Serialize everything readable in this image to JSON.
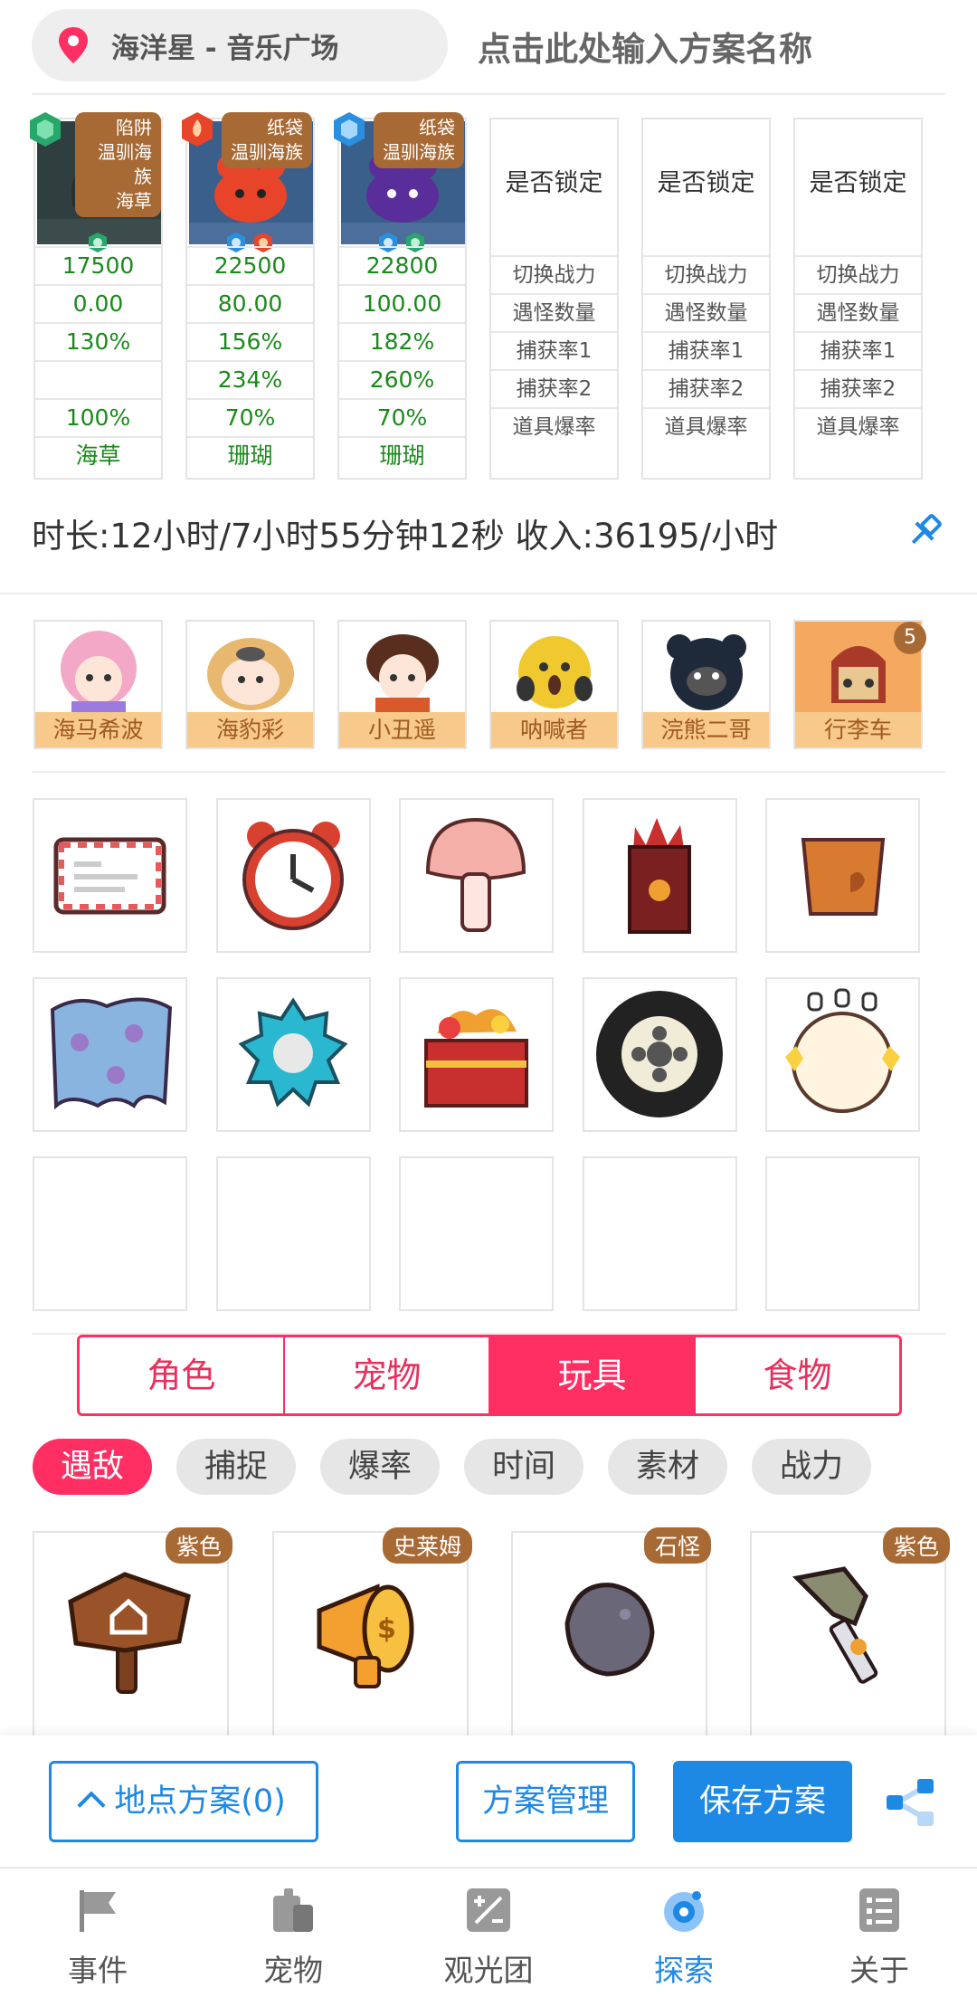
{
  "header": {
    "location": "海洋星 - 音乐广场",
    "plan_name_placeholder": "点击此处输入方案名称"
  },
  "characters": [
    {
      "tag": [
        "陷阱",
        "温驯海族",
        "海草"
      ],
      "gem_color": "#27a86a",
      "power": "17500",
      "encounter": "0.00",
      "capture1": "130%",
      "capture2": "",
      "drop": "100%",
      "material": "海草"
    },
    {
      "tag": [
        "纸袋",
        "温驯海族"
      ],
      "gem_color": "#e8442a",
      "power": "22500",
      "encounter": "80.00",
      "capture1": "156%",
      "capture2": "234%",
      "drop": "70%",
      "material": "珊瑚"
    },
    {
      "tag": [
        "纸袋",
        "温驯海族"
      ],
      "gem_color": "#2b8fe0",
      "power": "22800",
      "encounter": "100.00",
      "capture1": "182%",
      "capture2": "260%",
      "drop": "70%",
      "material": "珊瑚"
    }
  ],
  "empty_slot": {
    "lock": "是否锁定",
    "rows": [
      "切换战力",
      "遇怪数量",
      "捕获率1",
      "捕获率2",
      "道具爆率"
    ]
  },
  "summary": "时长:12小时/7小时55分钟12秒 收入:36195/小时",
  "party": [
    {
      "name": "海马希波"
    },
    {
      "name": "海豹彩"
    },
    {
      "name": "小丑遥"
    },
    {
      "name": "呐喊者"
    },
    {
      "name": "浣熊二哥"
    },
    {
      "name": "行李车",
      "count": "5"
    }
  ],
  "items": [
    "envelope",
    "alarm-clock",
    "mushroom",
    "red-box",
    "cork-block",
    "blue-cloth",
    "gear",
    "treasure-box",
    "tire",
    "pearl"
  ],
  "category_tabs": [
    {
      "label": "角色",
      "active": false
    },
    {
      "label": "宠物",
      "active": false
    },
    {
      "label": "玩具",
      "active": true
    },
    {
      "label": "食物",
      "active": false
    }
  ],
  "filter_chips": [
    {
      "label": "遇敌",
      "active": true
    },
    {
      "label": "捕捉",
      "active": false
    },
    {
      "label": "爆率",
      "active": false
    },
    {
      "label": "时间",
      "active": false
    },
    {
      "label": "素材",
      "active": false
    },
    {
      "label": "战力",
      "active": false
    }
  ],
  "toys": [
    {
      "tag": "紫色",
      "icon": "wooden-sign"
    },
    {
      "tag": "史莱姆",
      "icon": "money-megaphone"
    },
    {
      "tag": "石怪",
      "icon": "rock"
    },
    {
      "tag": "紫色",
      "icon": "sword"
    }
  ],
  "actions": {
    "location_plans": "地点方案(0)",
    "manage": "方案管理",
    "save": "保存方案"
  },
  "tabbar": [
    {
      "label": "事件",
      "active": false
    },
    {
      "label": "宠物",
      "active": false
    },
    {
      "label": "观光团",
      "active": false
    },
    {
      "label": "探索",
      "active": true
    },
    {
      "label": "关于",
      "active": false
    }
  ],
  "colors": {
    "accent": "#ff2e63",
    "primary": "#1e88e5",
    "tag_brown": "#a86a35",
    "stat_green": "#1a8a1a"
  }
}
